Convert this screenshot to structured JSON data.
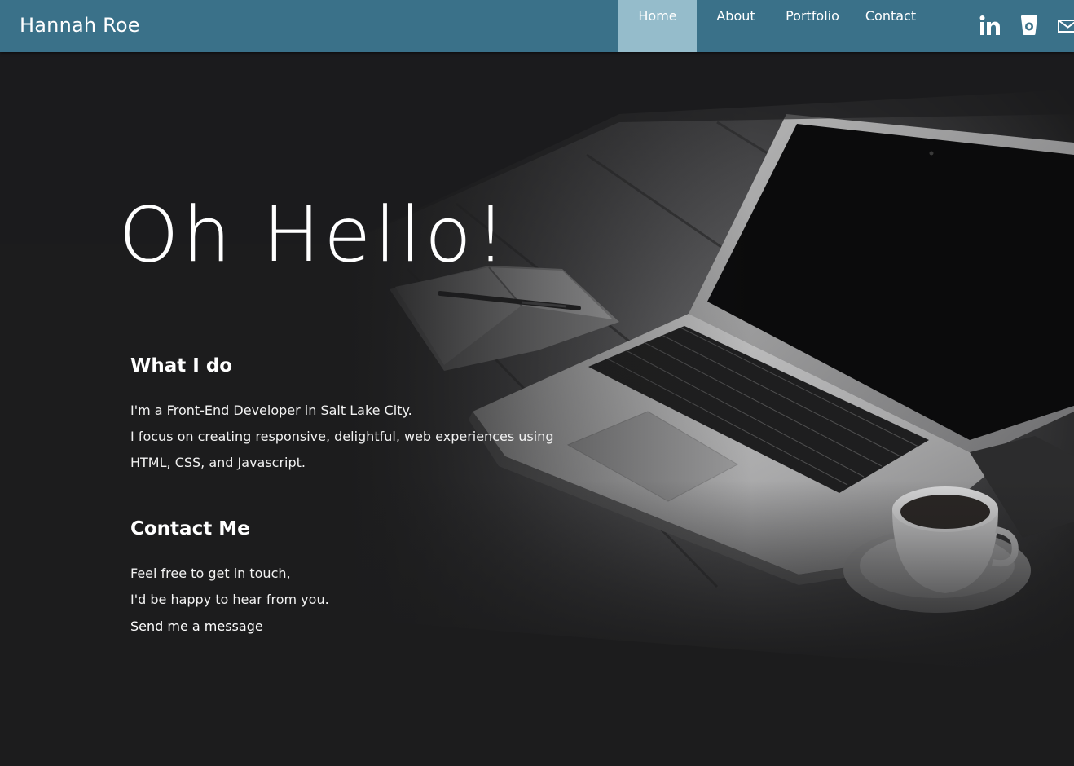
{
  "header": {
    "brand": "Hannah Roe",
    "nav": [
      {
        "label": "Home",
        "active": true
      },
      {
        "label": "About",
        "active": false
      },
      {
        "label": "Portfolio",
        "active": false
      },
      {
        "label": "Contact",
        "active": false
      }
    ],
    "social_icons": [
      "linkedin-icon",
      "dribbble-cup-icon",
      "mail-icon"
    ]
  },
  "hero": {
    "headline": "Oh Hello!"
  },
  "what_i_do": {
    "title": "What I do",
    "lines": [
      "I'm a Front-End Developer in Salt Lake City.",
      "I focus on creating responsive, delightful, web experiences using",
      "HTML, CSS, and Javascript."
    ]
  },
  "contact": {
    "title": "Contact Me",
    "lines": [
      "Feel free to get in touch,",
      "I'd be happy to hear from you."
    ],
    "link_label": "Send me a message"
  },
  "colors": {
    "header_bg": "#3a7189",
    "nav_active_bg": "#95bccb",
    "page_bg": "#1c1c1d"
  }
}
